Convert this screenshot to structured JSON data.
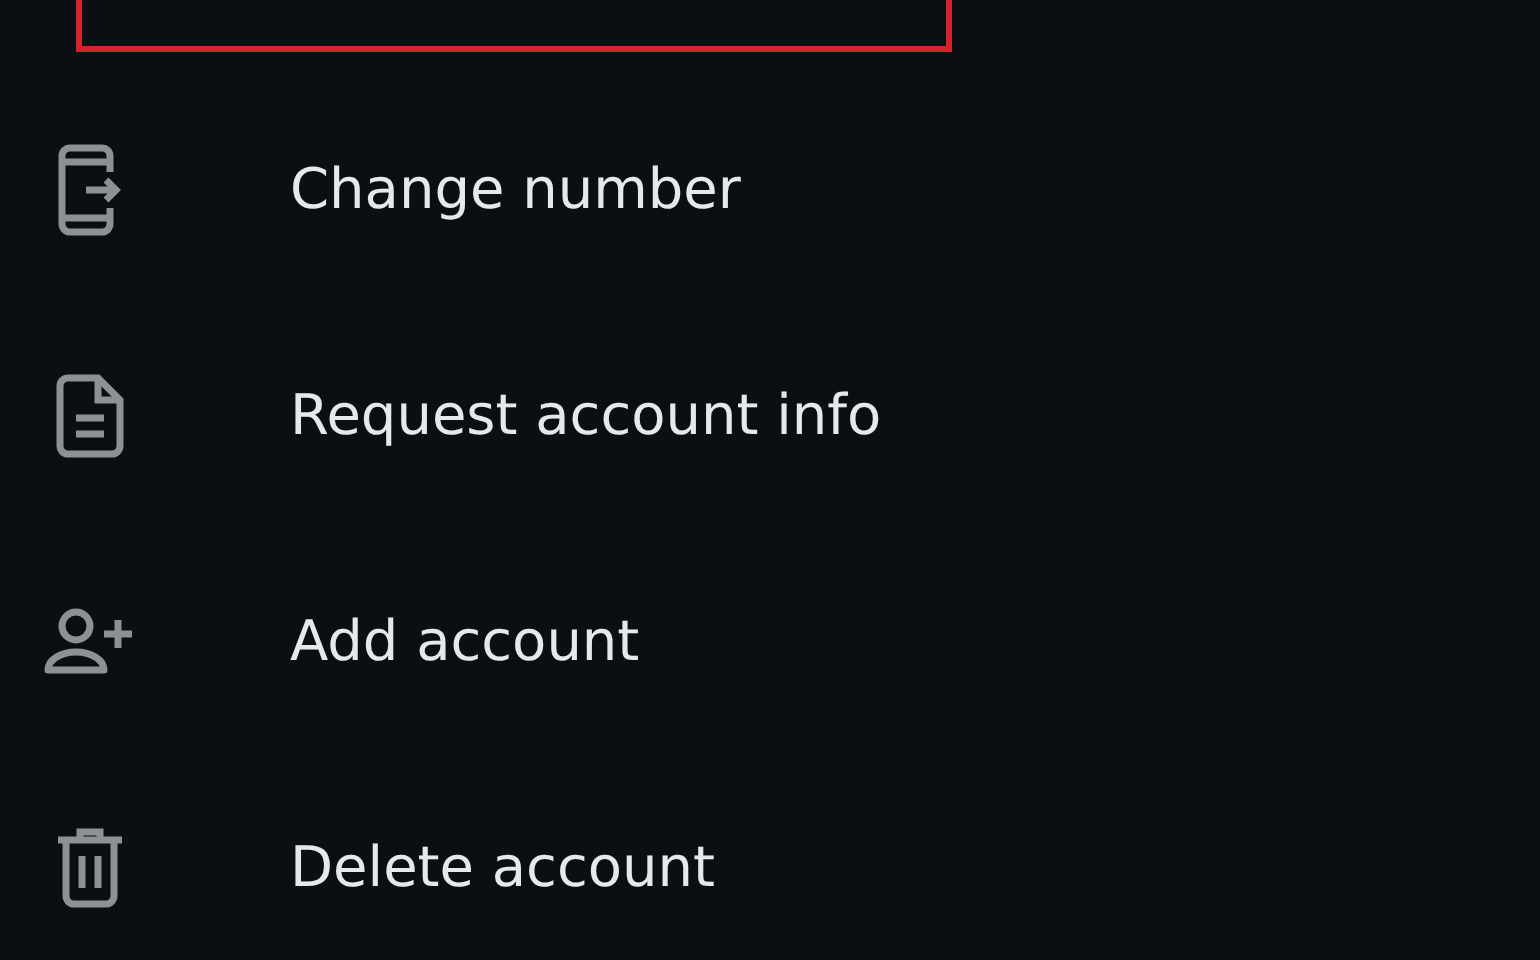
{
  "highlighted_item": {
    "highlighted": true
  },
  "items": [
    {
      "kind": "phone",
      "label": "Change number"
    },
    {
      "kind": "document",
      "label": "Request account info"
    },
    {
      "kind": "add-person",
      "label": "Add account"
    },
    {
      "kind": "trash",
      "label": "Delete account"
    }
  ]
}
